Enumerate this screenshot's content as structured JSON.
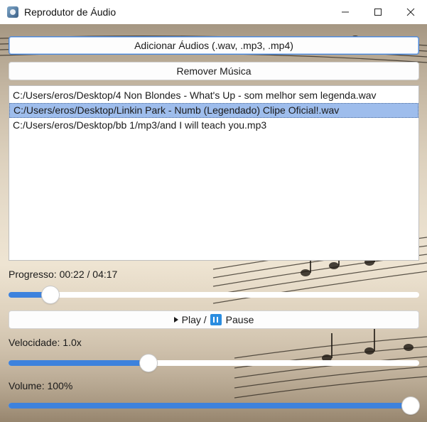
{
  "window": {
    "title": "Reprodutor de Áudio",
    "minimize_icon": "minimize-icon",
    "maximize_icon": "maximize-icon",
    "close_icon": "close-icon"
  },
  "buttons": {
    "add_label": "Adicionar Áudios (.wav, .mp3, .mp4)",
    "remove_label": "Remover Música",
    "play_label": "Play /",
    "pause_label": "Pause"
  },
  "playlist": {
    "items": [
      "C:/Users/eros/Desktop/4 Non Blondes - What's Up - som melhor sem legenda.wav",
      "C:/Users/eros/Desktop/Linkin Park - Numb (Legendado) Clipe Oficial!.wav",
      "C:/Users/eros/Desktop/bb 1/mp3/and I will teach you.mp3"
    ],
    "selected_index": 1
  },
  "progress": {
    "label": "Progresso: 00:22 / 04:17",
    "elapsed_seconds": 22,
    "total_seconds": 257
  },
  "speed": {
    "label": "Velocidade: 1.0x",
    "value": 1.0,
    "min": 0.5,
    "max": 2.0
  },
  "volume": {
    "label": "Volume: 100%",
    "value": 100,
    "min": 0,
    "max": 100
  },
  "colors": {
    "accent": "#3d82dd",
    "selection": "#9ebdec",
    "pause_icon": "#2a8de0"
  }
}
